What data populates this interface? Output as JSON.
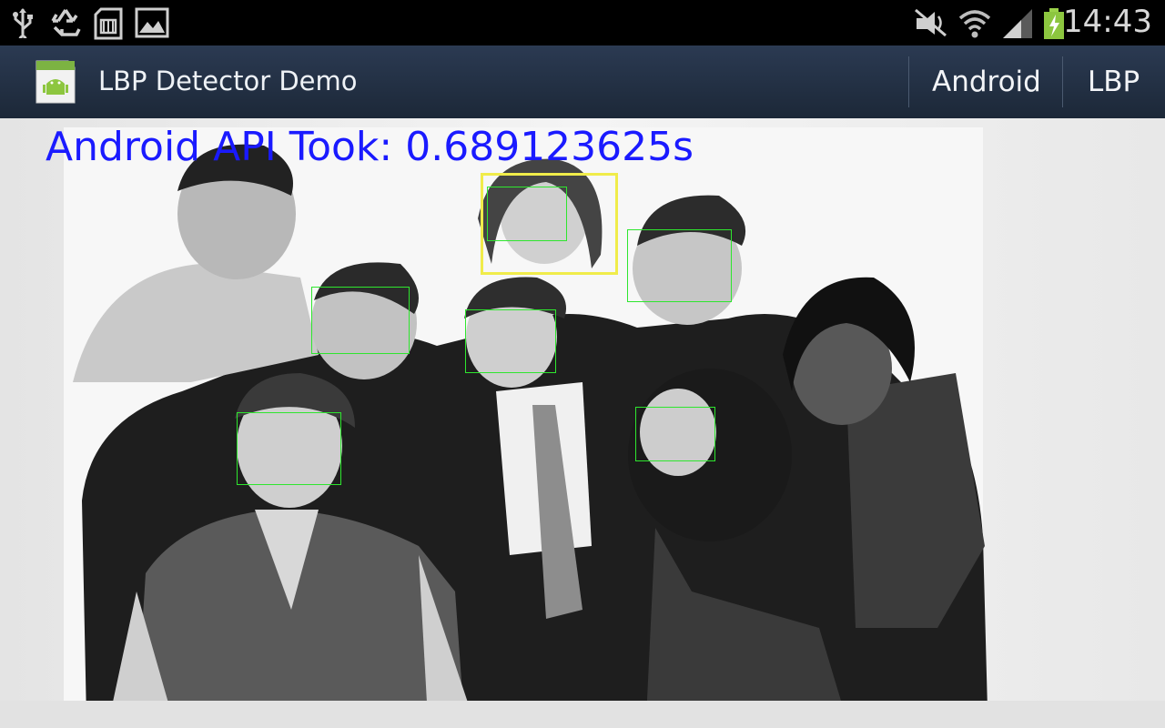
{
  "status_bar": {
    "time": "14:43",
    "icons": [
      "usb-icon",
      "recycle-icon",
      "sd-card-icon",
      "gallery-icon",
      "mute-icon",
      "wifi-icon",
      "signal-icon",
      "battery-charging-icon"
    ]
  },
  "action_bar": {
    "title": "LBP Detector Demo",
    "app_icon_label": "Android",
    "menu_items": [
      "Android",
      "LBP"
    ]
  },
  "content": {
    "timing_text": "Android API Took: 0.689123625s",
    "face_count": 8,
    "colors": {
      "timing_text": "#1a1aff",
      "face_box": "#2ee62e",
      "highlight_box": "#f0ec4a"
    }
  }
}
